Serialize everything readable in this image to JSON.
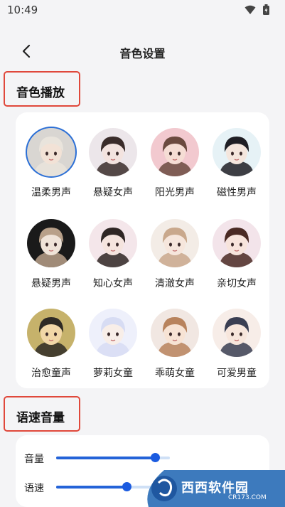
{
  "status_bar": {
    "time": "10:49"
  },
  "header": {
    "title": "音色设置"
  },
  "sections": {
    "voice_play": "音色播放",
    "speed_volume": "语速音量"
  },
  "voices": [
    {
      "label": "温柔男声",
      "selected": true,
      "bg": "#d9d6d2",
      "hair": "#e9e4dc",
      "skin": "#f2e2d6"
    },
    {
      "label": "悬疑女声",
      "selected": false,
      "bg": "#ece6ea",
      "hair": "#3a2c2a",
      "skin": "#f3e3df"
    },
    {
      "label": "阳光男声",
      "selected": false,
      "bg": "#f2c9cf",
      "hair": "#6b4a3f",
      "skin": "#f5ddd4"
    },
    {
      "label": "磁性男声",
      "selected": false,
      "bg": "#e6f2f6",
      "hair": "#1e1e24",
      "skin": "#f4e6dd"
    },
    {
      "label": "悬疑男声",
      "selected": false,
      "bg": "#1a1a1a",
      "hair": "#b8a089",
      "skin": "#efe3d8"
    },
    {
      "label": "知心女声",
      "selected": false,
      "bg": "#f4e6ea",
      "hair": "#2f2624",
      "skin": "#f5e4de"
    },
    {
      "label": "清澈女声",
      "selected": false,
      "bg": "#f3ece6",
      "hair": "#c9a88c",
      "skin": "#f6e6dc"
    },
    {
      "label": "亲切女声",
      "selected": false,
      "bg": "#f3e4ea",
      "hair": "#4a2a24",
      "skin": "#f7e4dc"
    },
    {
      "label": "治愈童声",
      "selected": false,
      "bg": "#c6b26b",
      "hair": "#2e2a24",
      "skin": "#f1d7a7"
    },
    {
      "label": "萝莉女童",
      "selected": false,
      "bg": "#eef0fb",
      "hair": "#d7dcf3",
      "skin": "#f8eee8"
    },
    {
      "label": "乖萌女童",
      "selected": false,
      "bg": "#f1e7e2",
      "hair": "#b8835d",
      "skin": "#f7e3d4"
    },
    {
      "label": "可爱男童",
      "selected": false,
      "bg": "#f7ede8",
      "hair": "#3a3e52",
      "skin": "#f7e6dc"
    }
  ],
  "sliders": [
    {
      "label": "音量",
      "level": 0.87
    },
    {
      "label": "语速",
      "level": 0.62
    }
  ],
  "watermark": {
    "text": "西西软件园",
    "sub": "CR173.COM"
  },
  "colors": {
    "accent": "#2463d8",
    "highlight_border": "#e0483b"
  }
}
